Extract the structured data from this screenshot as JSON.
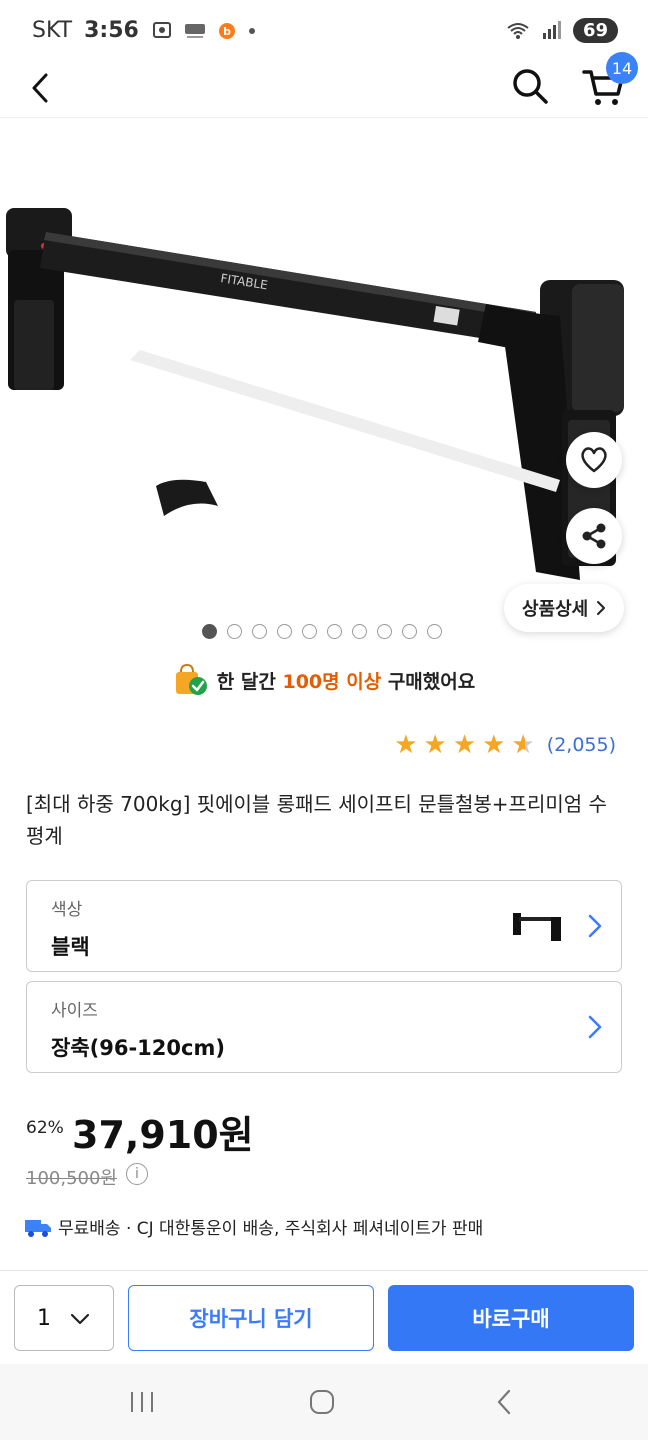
{
  "status_bar": {
    "carrier": "SKT",
    "time": "3:56",
    "battery": "69"
  },
  "header": {
    "cart_count": "14"
  },
  "gallery": {
    "total_images": 10,
    "active_index": 0,
    "detail_label": "상품상세"
  },
  "purchase_stat": {
    "prefix": "한 달간",
    "highlight": "100명 이상",
    "suffix": "구매했어요"
  },
  "rating": {
    "stars": 4.5,
    "review_count": "(2,055)"
  },
  "product": {
    "title": "[최대 하중 700kg] 핏에이블 롱패드 세이프티 문틀철봉+프리미엄 수평계"
  },
  "options": [
    {
      "label": "색상",
      "value": "블랙"
    },
    {
      "label": "사이즈",
      "value": "장축(96-120cm)"
    }
  ],
  "pricing": {
    "discount": "62%",
    "price": "37,910원",
    "original_price": "100,500원"
  },
  "shipping": {
    "text": "무료배송 · CJ 대한통운이 배송, 주식회사 페셔네이트가 판매"
  },
  "bottom_bar": {
    "quantity": "1",
    "cart_label": "장바구니 담기",
    "buy_label": "바로구매"
  },
  "colors": {
    "accent": "#3478f6",
    "highlight": "#e65c00",
    "star": "#f5a623",
    "review_link": "#3b6fd4"
  }
}
